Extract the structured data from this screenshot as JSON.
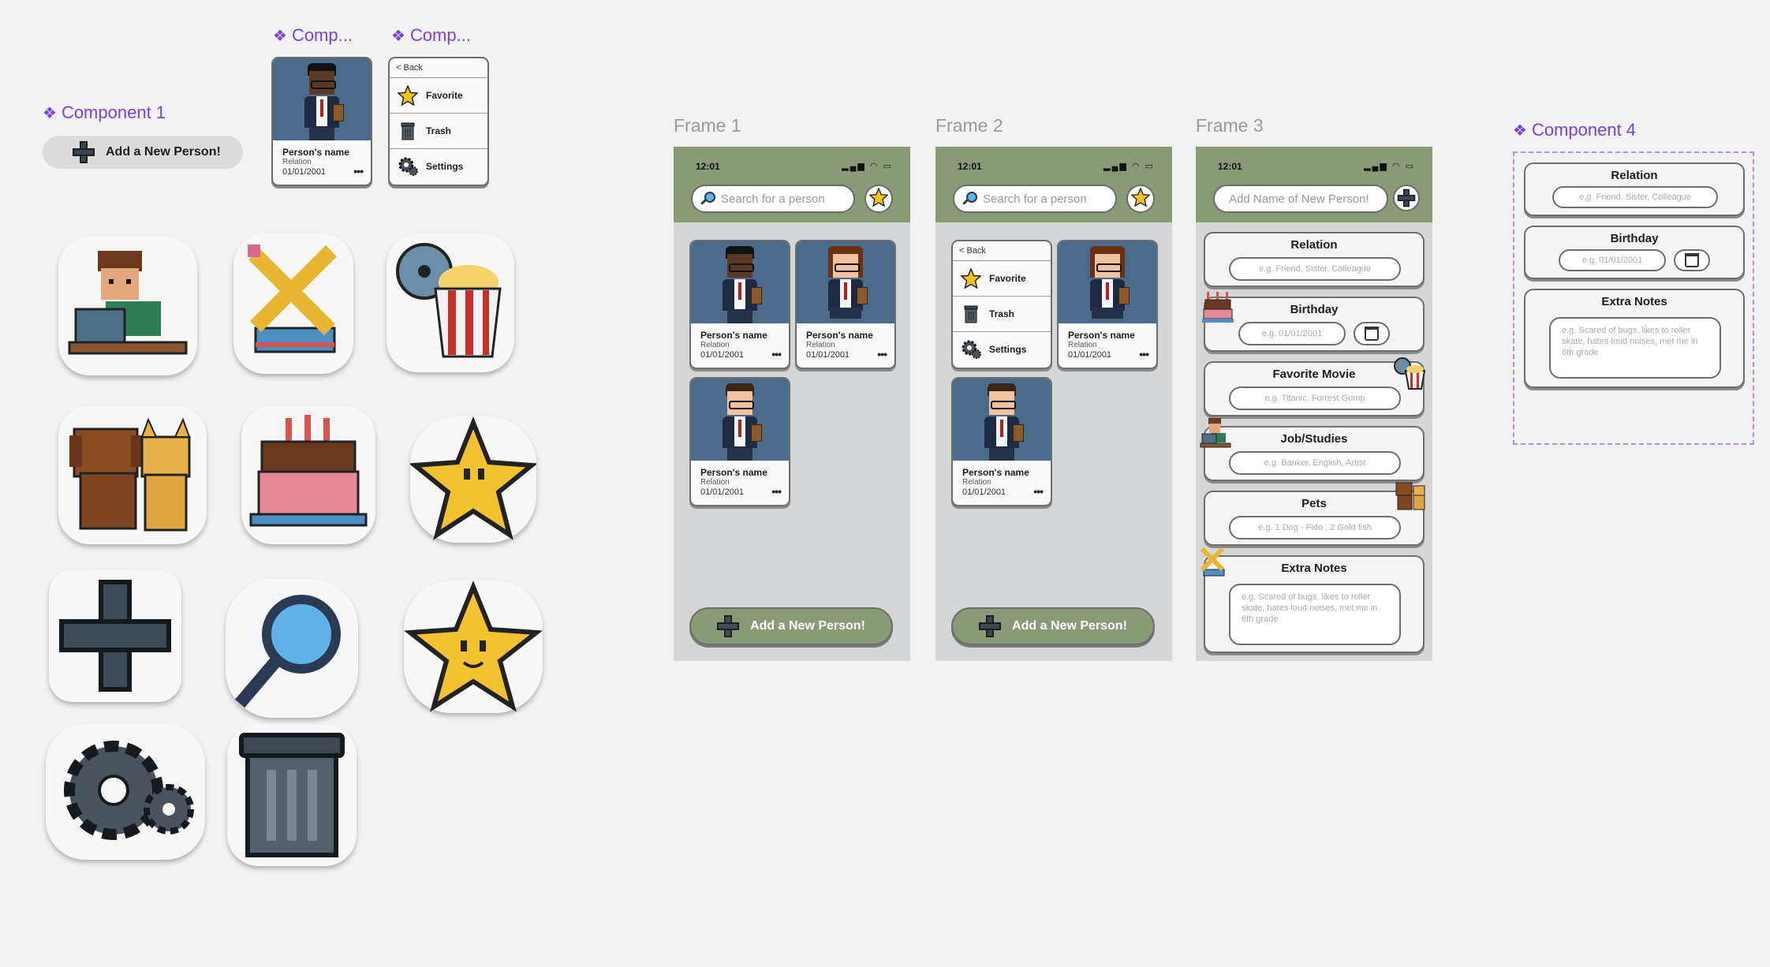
{
  "components": {
    "component1": {
      "label": "Component 1",
      "button_label": "Add a New Person!"
    },
    "component2": {
      "label": "Comp...",
      "card": {
        "name": "Person's name",
        "relation": "Relation",
        "date": "01/01/2001",
        "more": "•••"
      }
    },
    "component3": {
      "label": "Comp...",
      "back": "< Back",
      "items": [
        {
          "label": "Favorite",
          "icon": "star-icon"
        },
        {
          "label": "Trash",
          "icon": "trash-icon"
        },
        {
          "label": "Settings",
          "icon": "gear-icon"
        }
      ]
    },
    "component4": {
      "label": "Component 4",
      "fields": [
        {
          "title": "Relation",
          "placeholder": "e.g. Friend, Sister, Colleague"
        },
        {
          "title": "Birthday",
          "placeholder": "e.g. 01/01/2001"
        },
        {
          "title": "Extra Notes",
          "placeholder": "e.g. Scared of bugs, likes to roller skate, hates loud noises, met me in 6th grade"
        }
      ]
    }
  },
  "stickers": [
    "person-laptop-icon",
    "pencil-ruler-icon",
    "film-popcorn-icon",
    "dog-cat-icon",
    "birthday-cake-icon",
    "star-icon",
    "plus-icon",
    "magnifier-icon",
    "smiling-star-icon",
    "gear-icon",
    "trash-icon"
  ],
  "frames": {
    "frame1": {
      "label": "Frame 1",
      "status": {
        "time": "12:01",
        "icons": "▂▄▆ ◠ ▭"
      },
      "search_placeholder": "Search for a person",
      "cards": [
        {
          "name": "Person's name",
          "relation": "Relation",
          "date": "01/01/2001",
          "more": "•••"
        },
        {
          "name": "Person's name",
          "relation": "Relation",
          "date": "01/01/2001",
          "more": "•••"
        },
        {
          "name": "Person's name",
          "relation": "Relation",
          "date": "01/01/2001",
          "more": "•••"
        }
      ],
      "add_button": "Add a New Person!"
    },
    "frame2": {
      "label": "Frame 2",
      "status": {
        "time": "12:01",
        "icons": "▂▄▆ ◠ ▭"
      },
      "search_placeholder": "Search for a person",
      "menu": {
        "back": "< Back",
        "items": [
          "Favorite",
          "Trash",
          "Settings"
        ]
      },
      "cards": [
        {
          "name": "Person's name",
          "relation": "Relation",
          "date": "01/01/2001",
          "more": "•••"
        },
        {
          "name": "Person's name",
          "relation": "Relation",
          "date": "01/01/2001",
          "more": "•••"
        }
      ],
      "add_button": "Add a New Person!"
    },
    "frame3": {
      "label": "Frame 3",
      "status": {
        "time": "12:01",
        "icons": "▂▄▆ ◠ ▭"
      },
      "name_placeholder": "Add Name of New Person!",
      "fields": [
        {
          "title": "Relation",
          "placeholder": "e.g. Friend, Sister, Colleague"
        },
        {
          "title": "Birthday",
          "placeholder": "e.g. 01/01/2001"
        },
        {
          "title": "Favorite Movie",
          "placeholder": "e.g. Titanic, Forrest Gump"
        },
        {
          "title": "Job/Studies",
          "placeholder": "e.g. Banker, English, Artist"
        },
        {
          "title": "Pets",
          "placeholder": "e.g. 1 Dog - Fido , 2 Gold fish"
        },
        {
          "title": "Extra Notes",
          "placeholder": "e.g. Scared of bugs, likes to roller skate, hates loud noises, met me in 6th grade"
        }
      ]
    }
  },
  "colors": {
    "accent_purple": "#7b3fe4",
    "sage": "#8b9a76",
    "card_photo_bg": "#4c6a8a",
    "phone_bg": "#d5d6d8"
  }
}
